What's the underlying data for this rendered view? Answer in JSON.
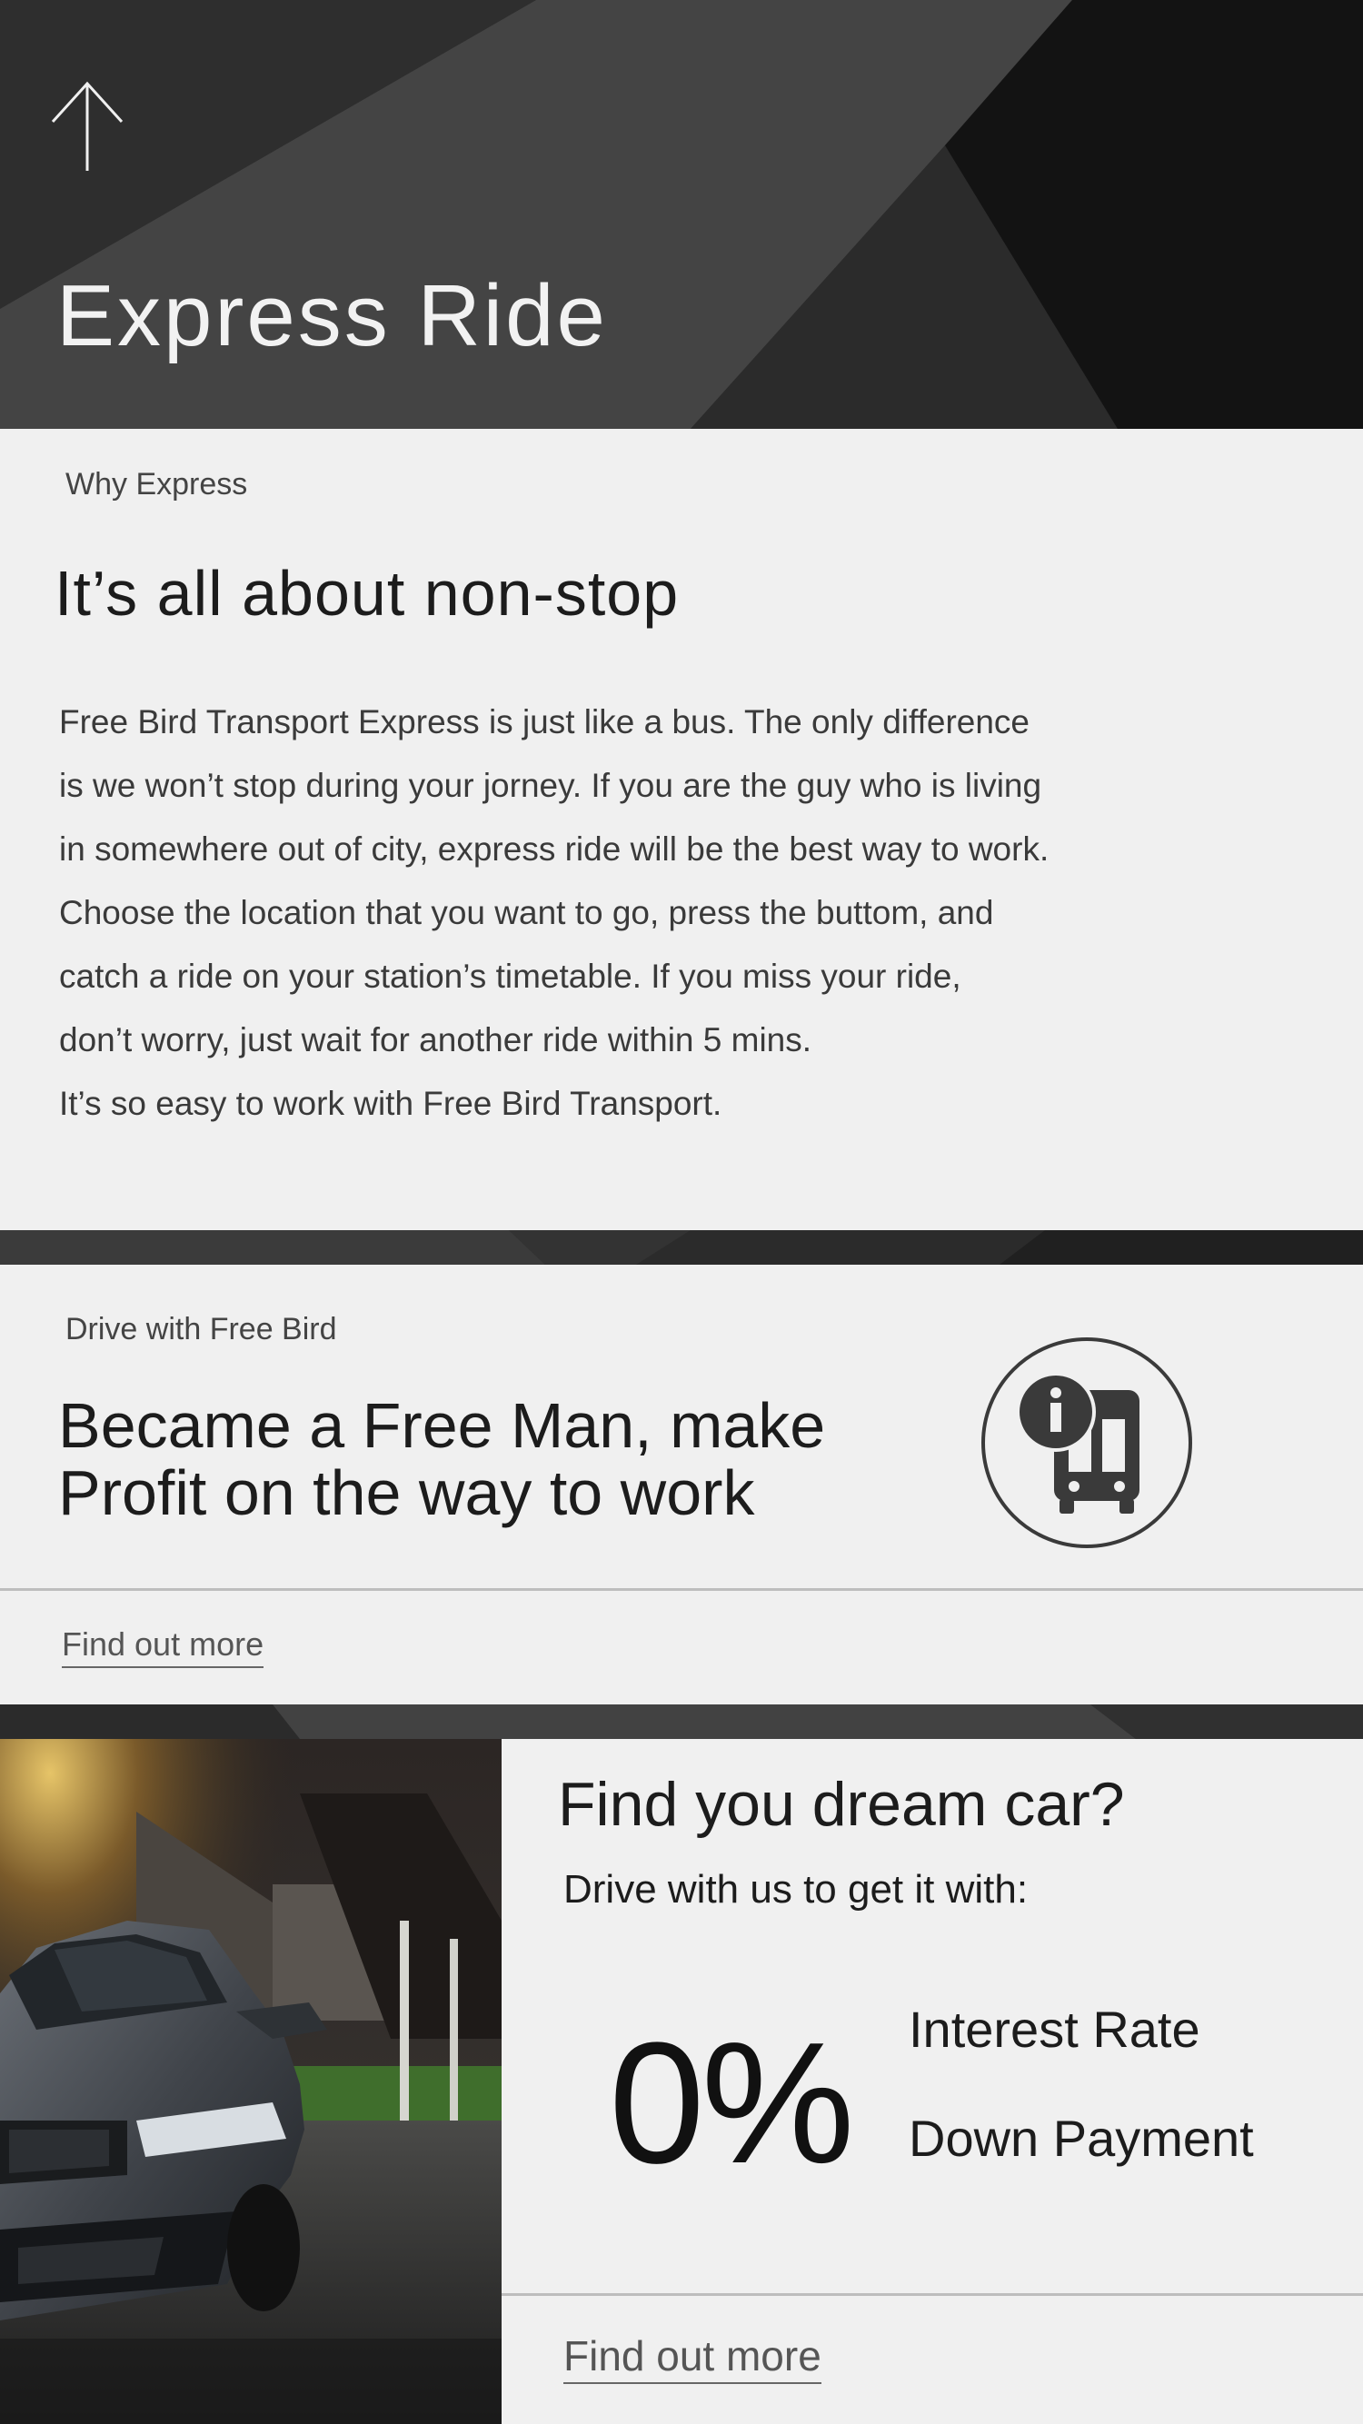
{
  "hero": {
    "title": "Express Ride",
    "back_icon": "arrow-up-icon"
  },
  "why": {
    "eyebrow": "Why Express",
    "heading": "It’s all about non-stop",
    "body_lines": [
      "Free Bird Transport Express is just like a bus. The only difference",
      "is we won’t stop during your jorney. If you are the guy who is living",
      "in somewhere out of city, express ride will be the best way to work.",
      "Choose the location that you want to go, press the buttom, and",
      "catch a ride on your station’s timetable. If you miss your ride,",
      "don’t worry, just wait for another ride within 5 mins.",
      "It’s so easy to work with Free Bird Transport."
    ]
  },
  "drive": {
    "eyebrow": "Drive with Free Bird",
    "heading_lines": [
      "Became a Free Man, make",
      "Profit on the way to work"
    ],
    "icon": "bus-info-icon",
    "link": "Find out more"
  },
  "car": {
    "heading": "Find you dream car?",
    "subheading": "Drive with us to get it with:",
    "rate": "0%",
    "perks": [
      "Interest Rate",
      "Down Payment"
    ],
    "link": "Find out more",
    "photo": "sports-car-photo"
  },
  "colors": {
    "page_bg": "#f0f0f0",
    "dark": "#2a2a2a",
    "text": "#1c1c1c",
    "muted": "#555555"
  }
}
